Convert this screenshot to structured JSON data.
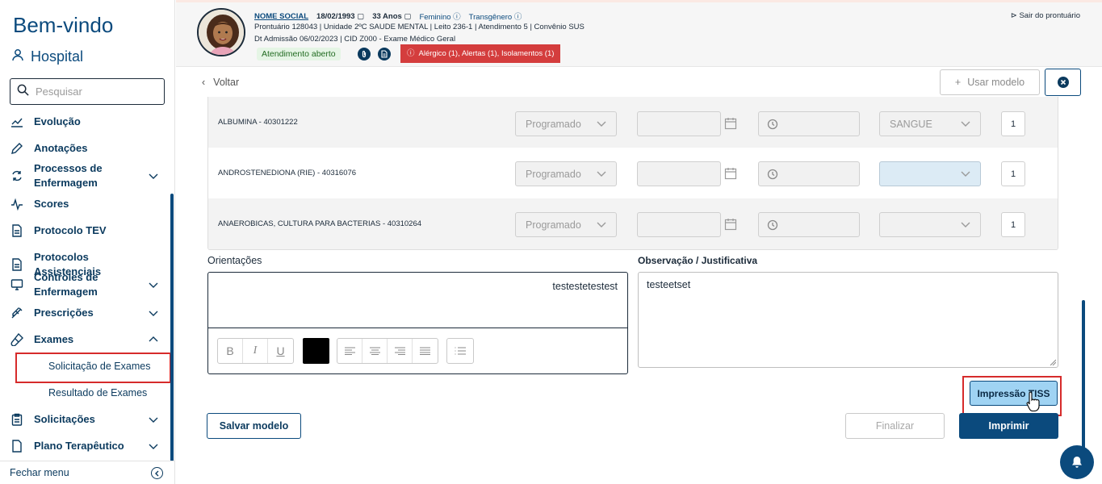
{
  "sidebar": {
    "welcome": "Bem-vindo",
    "hospital": "Hospital",
    "search_placeholder": "Pesquisar",
    "items": [
      {
        "label": "Evolução"
      },
      {
        "label": "Anotações"
      },
      {
        "label": "Processos de Enfermagem"
      },
      {
        "label": "Scores"
      },
      {
        "label": "Protocolo TEV"
      },
      {
        "label": "Protocolos Assistenciais"
      },
      {
        "label": "Controles de Enfermagem"
      },
      {
        "label": "Prescrições"
      },
      {
        "label": "Exames"
      },
      {
        "label": "Solicitações"
      },
      {
        "label": "Plano Terapêutico"
      }
    ],
    "exames_sub": [
      "Solicitação de Exames",
      "Resultado de Exames"
    ],
    "close_menu": "Fechar menu"
  },
  "patient": {
    "social_name": "NOME SOCIAL",
    "birth_date": "18/02/1993",
    "age": "33 Anos",
    "sex": "Feminino",
    "gender": "Transgênero",
    "line2": "Prontuário 128043  |  Unidade 2ºC SAUDE MENTAL  |  Leito 236-1  |  Atendimento 5  |  Convênio SUS",
    "line3": "Dt Admissão 06/02/2023  |  CID Z000 - Exame Médico Geral",
    "status": "Atendimento aberto",
    "alerts": "Alérgico (1),   Alertas (1),   Isolamentos (1)",
    "logout": "Sair do prontuário"
  },
  "toolbar": {
    "back": "Voltar",
    "use_model": "Usar modelo"
  },
  "exams": [
    {
      "name": "ALBUMINA - 40301222",
      "status": "Programado",
      "material": "SANGUE",
      "qty": "1"
    },
    {
      "name": "ANDROSTENEDIONA (RIE) - 40316076",
      "status": "Programado",
      "material": "",
      "qty": "1"
    },
    {
      "name": "ANAEROBICAS, CULTURA PARA BACTERIAS - 40310264",
      "status": "Programado",
      "material": "",
      "qty": "1"
    }
  ],
  "orientacoes": {
    "label": "Orientações",
    "text": "testestetestest"
  },
  "observacao": {
    "label": "Observação / Justificativa",
    "text": "testeetset"
  },
  "buttons": {
    "save_model": "Salvar modelo",
    "finalize": "Finalizar",
    "print": "Imprimir",
    "tiss": "Impressão TISS"
  },
  "colors": {
    "primary": "#0b4a7d",
    "alert": "#d43d3d",
    "status_bg": "#e5f5e5",
    "highlight": "#d62b2b",
    "tiss_bg": "#9fd3f3"
  }
}
